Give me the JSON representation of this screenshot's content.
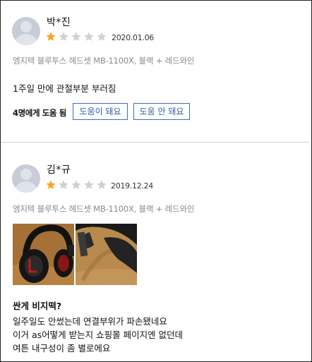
{
  "reviews": [
    {
      "author": "박*진",
      "rating": 1,
      "max_rating": 5,
      "date": "2020.01.06",
      "option": "엠지텍 블루투스 헤드셋 MB-1100X, 블랙 + 레드와인",
      "body": [
        "1주일 만에 관절부분 부러짐"
      ],
      "helpful_count_text": "4명에게 도움 됨",
      "helpful_button": "도움이 돼요",
      "not_helpful_button": "도움 안 돼요"
    },
    {
      "author": "김*규",
      "rating": 1,
      "max_rating": 5,
      "date": "2019.12.24",
      "option": "엠지텍 블루투스 헤드셋 MB-1100X, 블랙 + 레드와인",
      "title": "싼게 비지떡?",
      "body": [
        "일주일도 안썼는데 연결부위가 파손됐네요",
        "이거 as어떻게 받는지 쇼핑몰 페이지엔 없던데",
        "여튼 내구성이 좀 별로에요"
      ],
      "photos": [
        "headset-photo-icon",
        "broken-hinge-photo-icon"
      ]
    }
  ],
  "colors": {
    "star_filled": "#f5a623",
    "star_empty": "#d0d0d0",
    "button_border": "#3d6fb5",
    "button_text": "#2c5ca8",
    "option_text": "#8a8a8a"
  }
}
